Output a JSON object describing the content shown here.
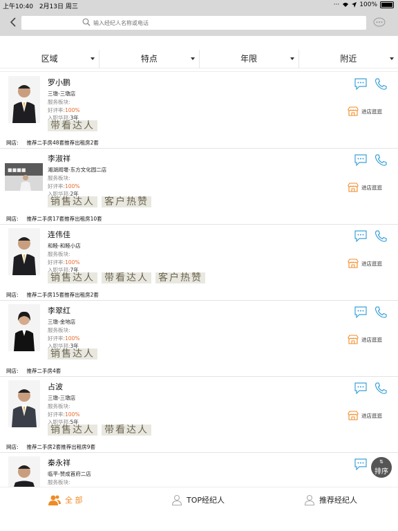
{
  "status": {
    "time": "上午10:40",
    "date": "2月13日 周三",
    "battery": "100%"
  },
  "search": {
    "placeholder": "输入经纪人名称或电话"
  },
  "filters": [
    "区域",
    "特点",
    "年限",
    "附近"
  ],
  "labels": {
    "plate": "服务板块:",
    "rate": "好评率:",
    "years": "入职华邦:",
    "store_prefix": "网店:",
    "visit_store": "进店逛逛"
  },
  "agents": [
    {
      "name": "罗小鹏",
      "store": "三墩-三墩店",
      "rate": "100%",
      "years": "3年",
      "tags": [
        "带看达人"
      ],
      "listings": [
        "推荐二手房48套推荐出租房2套"
      ]
    },
    {
      "name": "李淑祥",
      "store": "湘湖闻堰-东方文化园二店",
      "rate": "100%",
      "years": "2年",
      "tags": [
        "销售达人",
        "客户热赞"
      ],
      "listings": [
        "推荐二手房17套推荐出租房10套"
      ]
    },
    {
      "name": "连伟佳",
      "store": "和睦-和睦小店",
      "rate": "100%",
      "years": "7年",
      "tags": [
        "销售达人",
        "带看达人",
        "客户热赞"
      ],
      "listings": [
        "推荐二手房15套推荐出租房2套"
      ]
    },
    {
      "name": "李翠红",
      "store": "三墩-金地店",
      "rate": "100%",
      "years": "3年",
      "tags": [
        "销售达人"
      ],
      "listings": [
        "推荐二手房4套"
      ]
    },
    {
      "name": "占波",
      "store": "三墩-三墩店",
      "rate": "100%",
      "years": "5年",
      "tags": [
        "销售达人",
        "带看达人"
      ],
      "listings": [
        "推荐二手房2套推荐出租房9套"
      ]
    },
    {
      "name": "秦永祥",
      "store": "临平-赞成首府二店",
      "rate": "",
      "years": "",
      "tags": [],
      "listings": []
    }
  ],
  "sort_button": {
    "label": "排序"
  },
  "tabs": [
    {
      "label": "全 部",
      "active": true
    },
    {
      "label": "TOP经纪人",
      "active": false
    },
    {
      "label": "推荐经纪人",
      "active": false
    }
  ],
  "colors": {
    "accent": "#f08a24",
    "rate": "#e86a2c",
    "icon_blue": "#3aa0d8",
    "nav_bg": "#d8d8d8"
  }
}
